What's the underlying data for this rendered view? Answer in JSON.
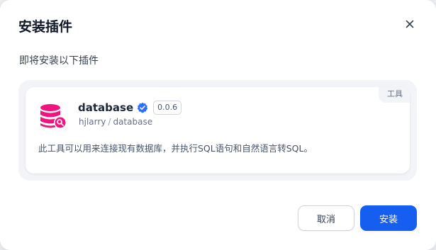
{
  "dialog": {
    "title": "安装插件",
    "subtitle": "即将安装以下插件",
    "close_icon": "close-icon"
  },
  "plugin": {
    "icon": "database-search-icon",
    "icon_color": "#f0157e",
    "name": "database",
    "verified_icon": "verified-badge-icon",
    "verified_color": "#2970ff",
    "version": "0.0.6",
    "author": "hjlarry",
    "separator": "/",
    "slug": "database",
    "category": "工具",
    "description": "此工具可以用来连接现有数据库，并执行SQL语句和自然语言转SQL。"
  },
  "actions": {
    "cancel_label": "取消",
    "install_label": "安装",
    "primary_color": "#155eef"
  }
}
